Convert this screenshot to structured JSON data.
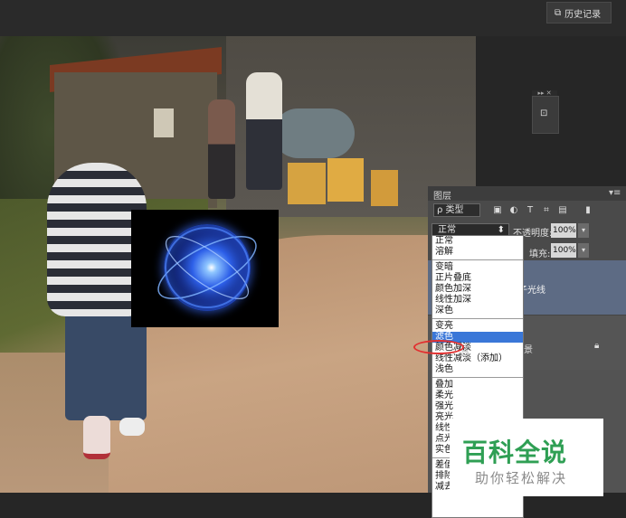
{
  "toolbar": {
    "history_label": "历史记录"
  },
  "layers_panel": {
    "title": "图层",
    "filter": {
      "label": "ρ 类型"
    },
    "filter_icons": [
      "image-filter-icon",
      "adjust-filter-icon",
      "type-filter-icon",
      "shape-filter-icon",
      "smart-filter-icon"
    ],
    "blend_mode": "正常",
    "opacity_label": "不透明度:",
    "opacity_value": "100%",
    "fill_label": "填充:",
    "fill_value": "100%",
    "layers": [
      {
        "name": "子光线"
      },
      {
        "name": "景"
      }
    ]
  },
  "blend_modes": {
    "group1": [
      "正常",
      "溶解"
    ],
    "group2": [
      "变暗",
      "正片叠底",
      "颜色加深",
      "线性加深",
      "深色"
    ],
    "group3": [
      "变亮",
      "滤色",
      "颜色减淡",
      "线性减淡（添加）",
      "浅色"
    ],
    "group4": [
      "叠加",
      "柔光",
      "强光",
      "亮光",
      "线性",
      "点光",
      "实色"
    ],
    "group5": [
      "差值",
      "排除",
      "减去"
    ],
    "selected": "滤色"
  },
  "watermark": {
    "title": "百科全说",
    "subtitle": "助你轻松解决"
  },
  "colors": {
    "selection": "#3a77d8",
    "annotation": "#e23030",
    "watermark_green": "#2f9f54"
  }
}
